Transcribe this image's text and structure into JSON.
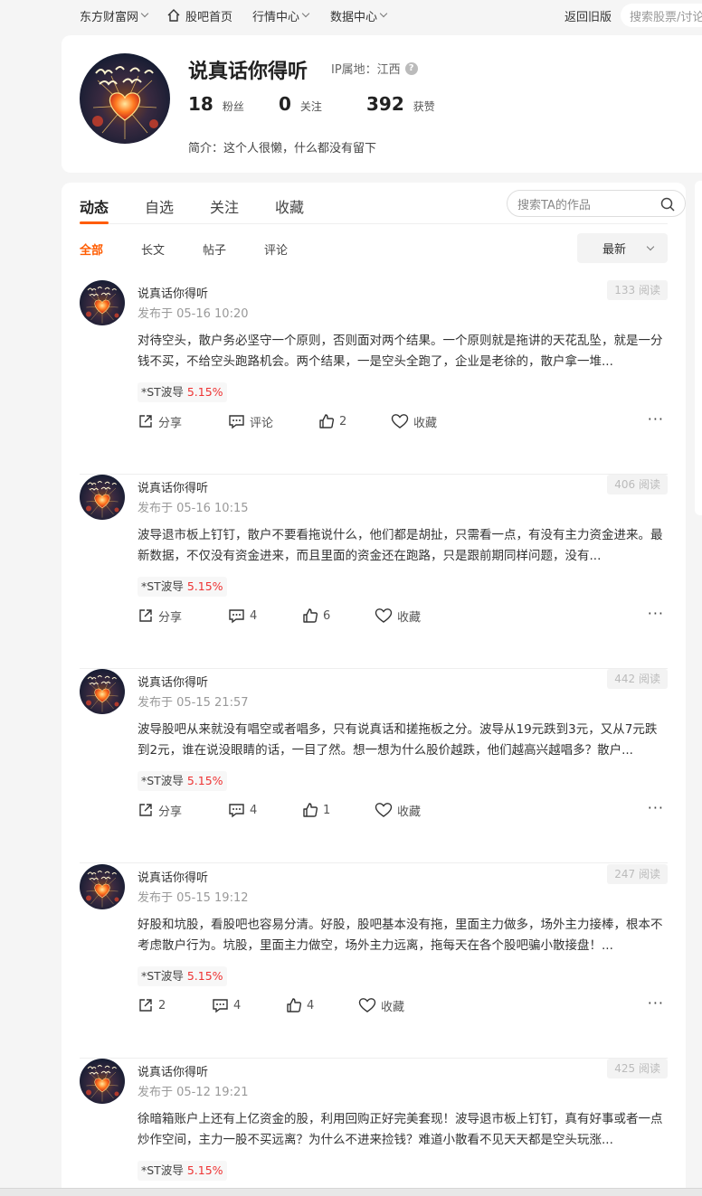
{
  "topnav": {
    "site": "东方财富网",
    "home": "股吧首页",
    "market": "行情中心",
    "data": "数据中心",
    "old_version": "返回旧版",
    "search_placeholder": "搜索股票/讨论"
  },
  "profile": {
    "name": "说真话你得听",
    "ip_label": "IP属地：江西",
    "followers": "18",
    "followers_label": "粉丝",
    "following": "0",
    "following_label": "关注",
    "likes": "392",
    "likes_label": "获赞",
    "bio": "简介：这个人很懒，什么都没有留下"
  },
  "tabs": [
    "动态",
    "自选",
    "关注",
    "收藏"
  ],
  "tab_search_placeholder": "搜索TA的作品",
  "subtabs": [
    "全部",
    "长文",
    "帖子",
    "评论"
  ],
  "sort": "最新",
  "posts": [
    {
      "author": "说真话你得听",
      "time": "发布于 05-16 10:20",
      "reads": "133 阅读",
      "content": "对待空头，散户务必坚守一个原则，否则面对两个结果。一个原则就是拖讲的天花乱坠，就是一分钱不买，不给空头跑路机会。两个结果，一是空头全跑了，企业是老徐的，散户拿一堆...",
      "stock": "*ST波导",
      "change": "5.15%",
      "share": "分享",
      "comment": "评论",
      "likes": "2",
      "collect": "收藏"
    },
    {
      "author": "说真话你得听",
      "time": "发布于 05-16 10:15",
      "reads": "406 阅读",
      "content": "波导退市板上钉钉，散户不要看拖说什么，他们都是胡扯，只需看一点，有没有主力资金进来。最新数据，不仅没有资金进来，而且里面的资金还在跑路，只是跟前期同样问题，没有...",
      "stock": "*ST波导",
      "change": "5.15%",
      "share": "分享",
      "comment": "4",
      "likes": "6",
      "collect": "收藏"
    },
    {
      "author": "说真话你得听",
      "time": "发布于 05-15 21:57",
      "reads": "442 阅读",
      "content": "波导股吧从来就没有唱空或者唱多，只有说真话和搓拖板之分。波导从19元跌到3元，又从7元跌到2元，谁在说没眼睛的话，一目了然。想一想为什么股价越跌，他们越高兴越唱多？散户...",
      "stock": "*ST波导",
      "change": "5.15%",
      "share": "分享",
      "comment": "4",
      "likes": "1",
      "collect": "收藏"
    },
    {
      "author": "说真话你得听",
      "time": "发布于 05-15 19:12",
      "reads": "247 阅读",
      "content": "好股和坑股，看股吧也容易分清。好股，股吧基本没有拖，里面主力做多，场外主力接棒，根本不考虑散户行为。坑股，里面主力做空，场外主力远离，拖每天在各个股吧骗小散接盘！...",
      "stock": "*ST波导",
      "change": "5.15%",
      "share": "2",
      "comment": "4",
      "likes": "4",
      "collect": "收藏"
    },
    {
      "author": "说真话你得听",
      "time": "发布于 05-12 19:21",
      "reads": "425 阅读",
      "content": "徐暗箱账户上还有上亿资金的股，利用回购正好完美套现！波导退市板上钉钉，真有好事或者一点炒作空间，主力一股不买远离？为什么不进来捡钱？难道小散看不见天天都是空头玩涨...",
      "stock": "*ST波导",
      "change": "5.15%"
    }
  ]
}
